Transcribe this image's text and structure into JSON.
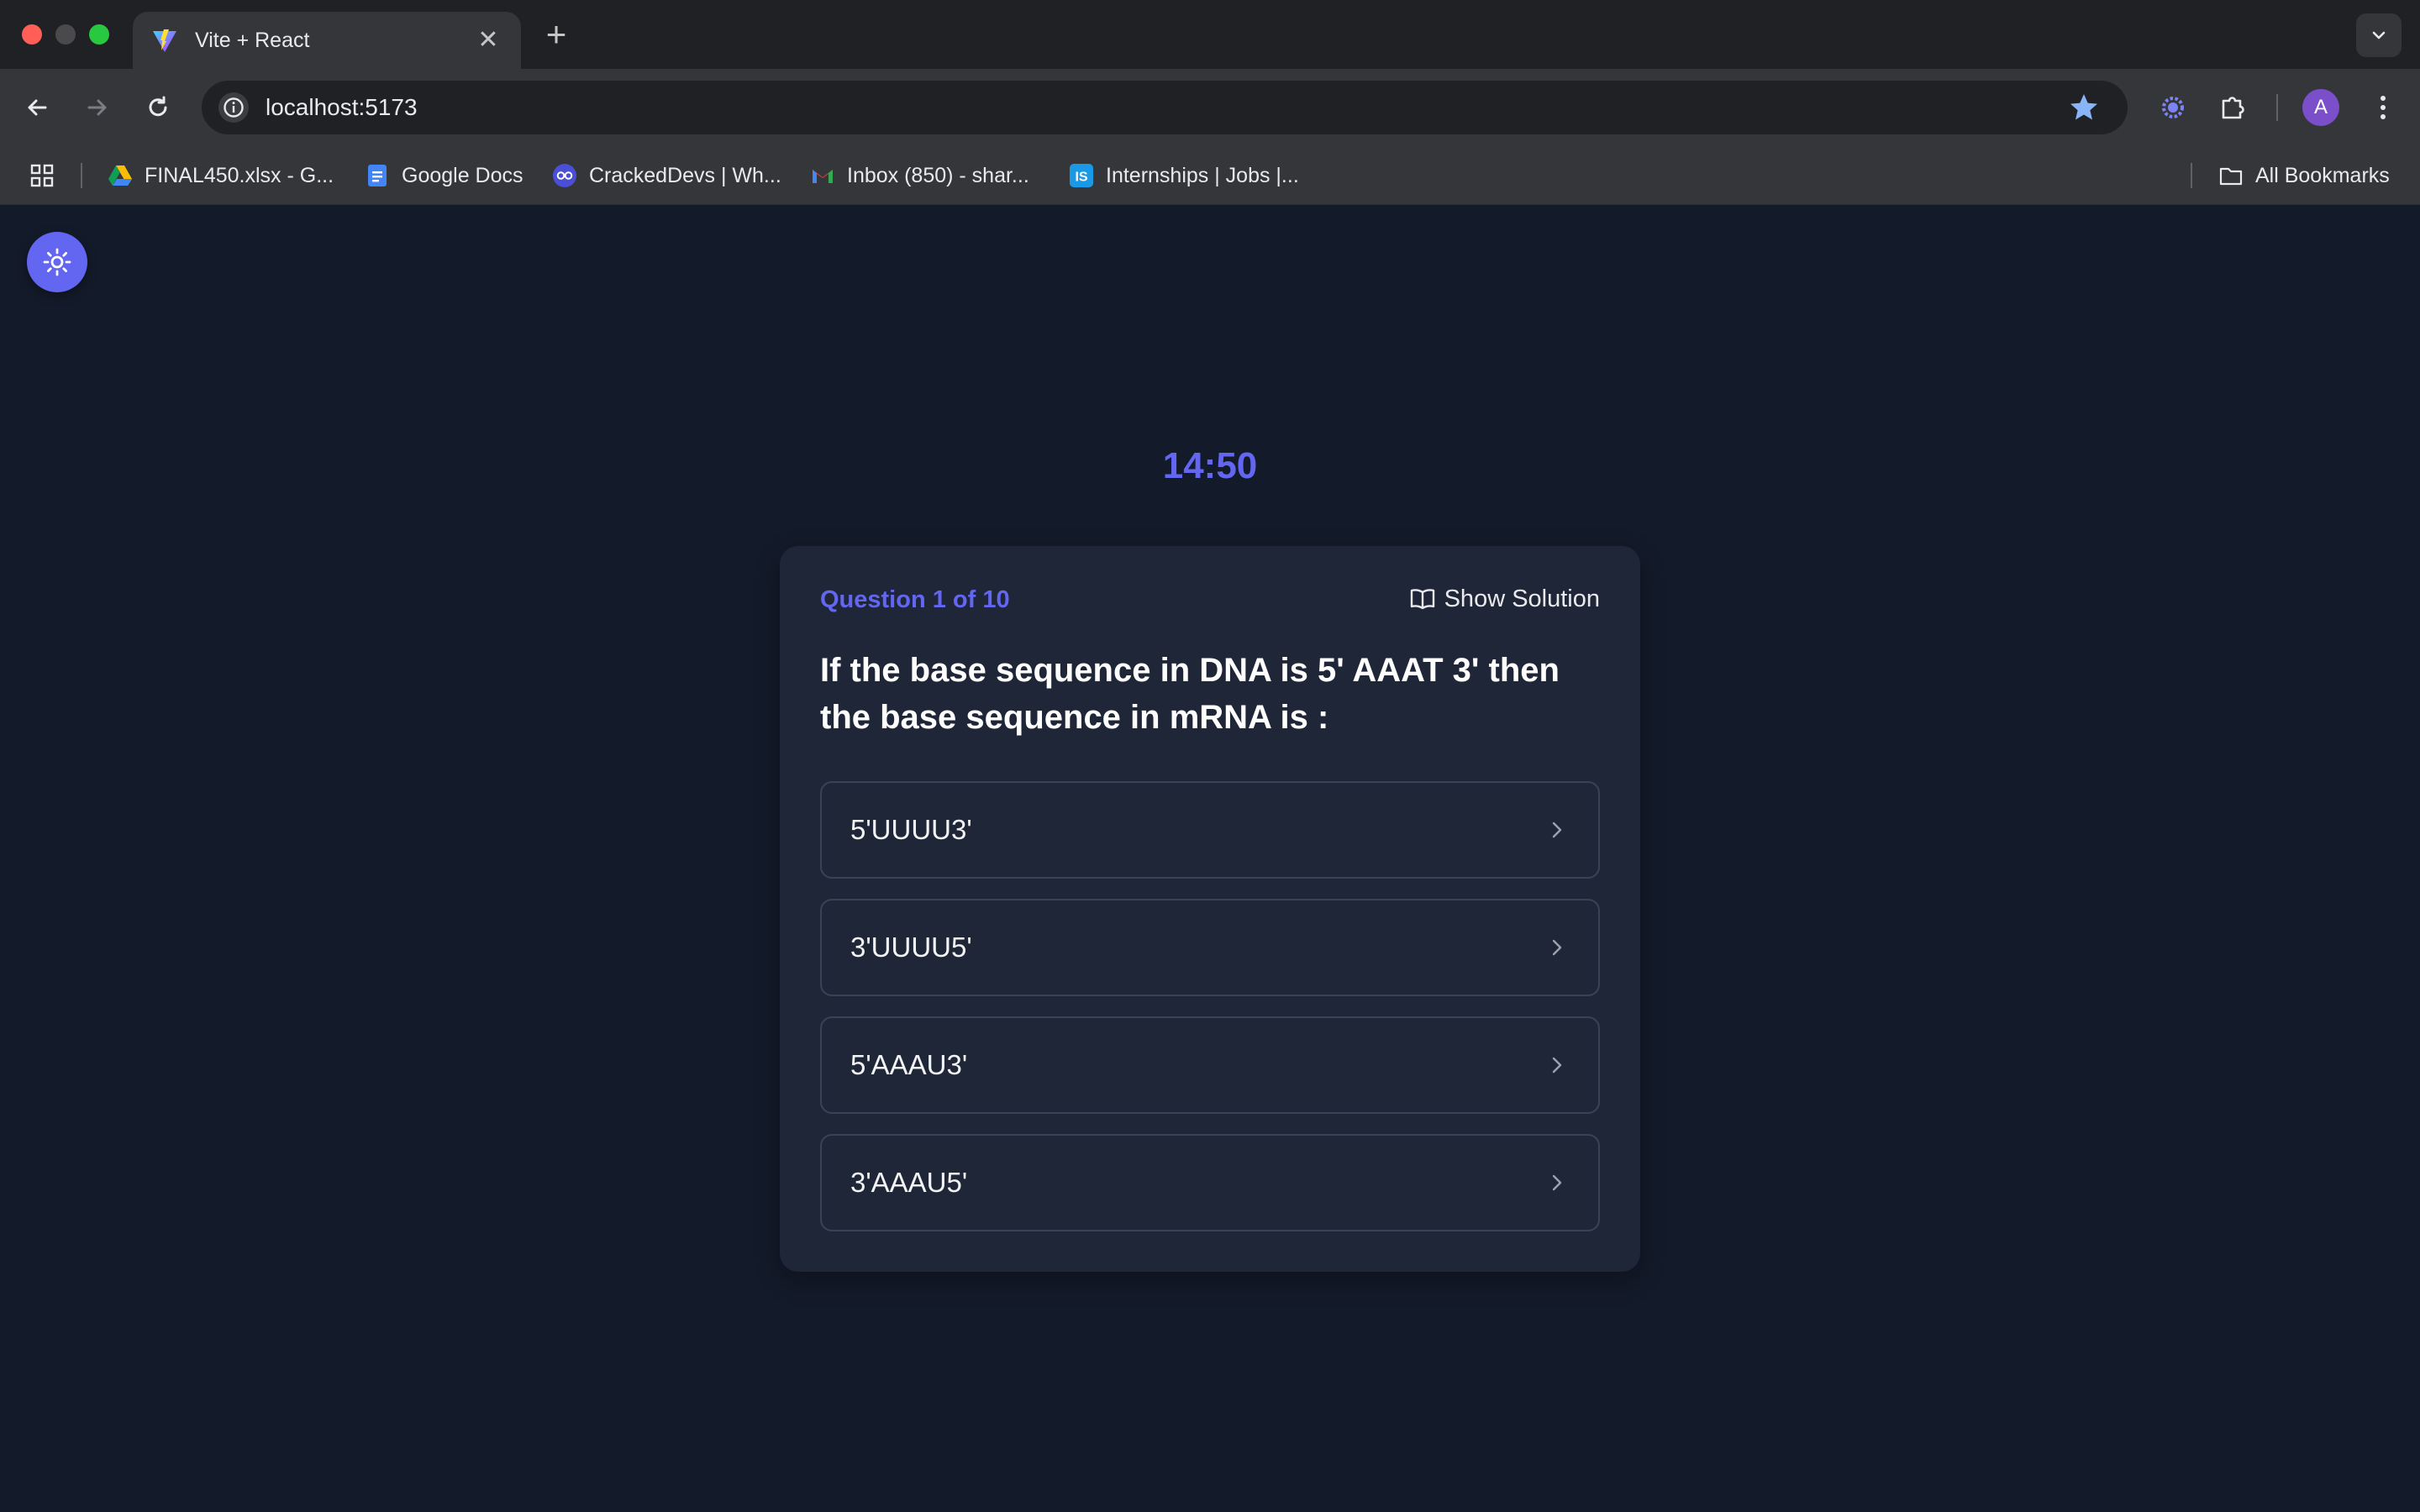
{
  "browser": {
    "tab_title": "Vite + React",
    "tab_close": "✕",
    "new_tab": "+",
    "url": "localhost:5173",
    "avatar_letter": "A",
    "bookmarks": [
      {
        "label": "FINAL450.xlsx - G...",
        "icon": "google-drive-icon"
      },
      {
        "label": "Google Docs",
        "icon": "google-docs-icon"
      },
      {
        "label": "CrackedDevs | Wh...",
        "icon": "crackeddevs-icon"
      },
      {
        "label": "Inbox (850) - shar...",
        "icon": "gmail-icon"
      },
      {
        "label": "Internships | Jobs |...",
        "icon": "internshala-icon"
      }
    ],
    "all_bookmarks": "All Bookmarks"
  },
  "quiz": {
    "timer": "14:50",
    "counter": "Question 1 of 10",
    "show_solution": "Show Solution",
    "question": "If the base sequence in DNA is 5' AAAT 3' then the base sequence in mRNA is :",
    "options": [
      "5'UUUU3'",
      "3'UUUU5'",
      "5'AAAU3'",
      "3'AAAU5'"
    ]
  },
  "colors": {
    "accent": "#6366f1",
    "page_bg": "#131a29",
    "card_bg": "#1f2637",
    "option_border": "#3a4255"
  }
}
